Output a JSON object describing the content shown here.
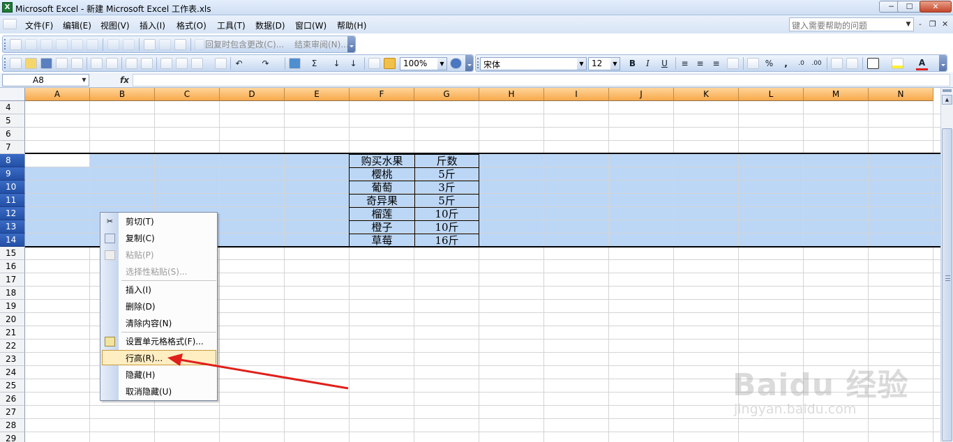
{
  "window": {
    "title": "Microsoft Excel - 新建 Microsoft Excel 工作表.xls",
    "app_icon_glyph": "X",
    "minimize": "─",
    "maximize": "☐",
    "close": "✕"
  },
  "menubar": {
    "items": [
      "文件(F)",
      "编辑(E)",
      "视图(V)",
      "插入(I)",
      "格式(O)",
      "工具(T)",
      "数据(D)",
      "窗口(W)",
      "帮助(H)"
    ],
    "help_placeholder": "键入需要帮助的问题",
    "mdi_min": "-",
    "mdi_restore": "❐",
    "mdi_close": "✕"
  },
  "review_toolbar": {
    "reply_changes": "回复时包含更改(C)...",
    "end_review": "结束审阅(N)..."
  },
  "standard_toolbar": {
    "zoom": "100%",
    "sigma": "Σ"
  },
  "formatting_toolbar": {
    "font": "宋体",
    "size": "12",
    "bold": "B",
    "italic": "I",
    "underline": "U",
    "percent": "%",
    "comma": ",",
    "font_color_glyph": "A"
  },
  "formula_bar": {
    "name_box": "A8",
    "fx": "fx",
    "formula": ""
  },
  "grid": {
    "columns": [
      "A",
      "B",
      "C",
      "D",
      "E",
      "F",
      "G",
      "H",
      "I",
      "J",
      "K",
      "L",
      "M",
      "N"
    ],
    "rows": [
      "4",
      "5",
      "6",
      "7",
      "8",
      "9",
      "10",
      "11",
      "12",
      "13",
      "14",
      "15",
      "16",
      "17",
      "18",
      "19",
      "20",
      "21",
      "22",
      "23",
      "24",
      "25",
      "26",
      "27",
      "28",
      "29"
    ],
    "selected_rows": [
      "8",
      "9",
      "10",
      "11",
      "12",
      "13",
      "14"
    ],
    "table": [
      [
        "购买水果",
        "斤数"
      ],
      [
        "樱桃",
        "5斤"
      ],
      [
        "葡萄",
        "3斤"
      ],
      [
        "奇异果",
        "5斤"
      ],
      [
        "榴莲",
        "10斤"
      ],
      [
        "橙子",
        "10斤"
      ],
      [
        "草莓",
        "16斤"
      ]
    ]
  },
  "context_menu": {
    "cut": "剪切(T)",
    "copy": "复制(C)",
    "paste": "粘贴(P)",
    "paste_special": "选择性粘贴(S)...",
    "insert": "插入(I)",
    "delete": "删除(D)",
    "clear_contents": "清除内容(N)",
    "format_cells": "设置单元格格式(F)...",
    "row_height": "行高(R)...",
    "hide": "隐藏(H)",
    "unhide": "取消隐藏(U)"
  },
  "watermark": {
    "logo": "Baidu 经验",
    "url": "jingyan.baidu.com"
  },
  "colors": {
    "accent_arrow": "#e0201b",
    "selection": "#bcd7f6",
    "header_orange": "#f7a84a"
  }
}
